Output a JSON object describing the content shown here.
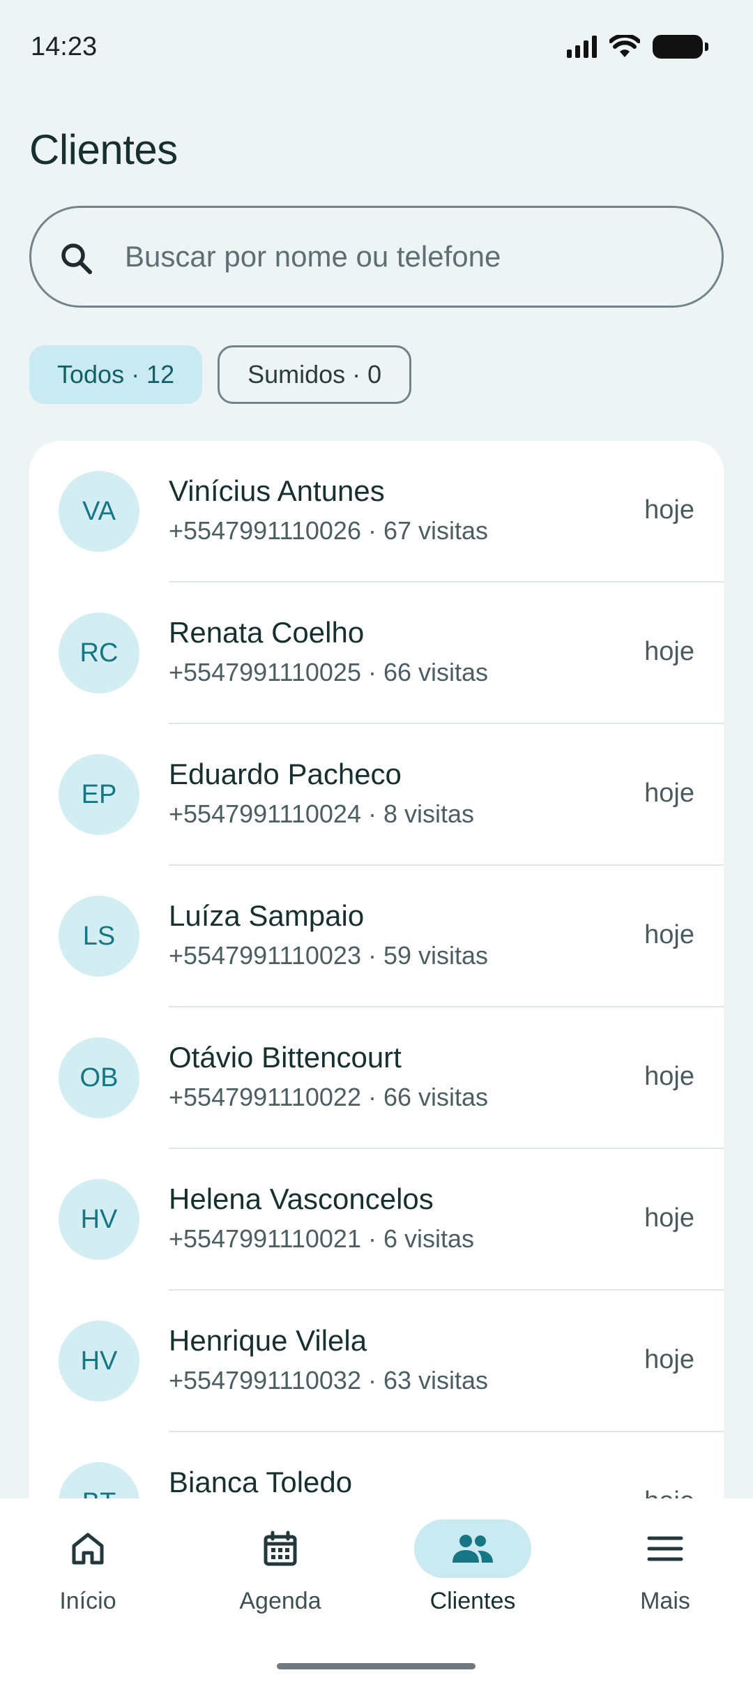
{
  "status_bar": {
    "time": "14:23"
  },
  "header": {
    "title": "Clientes"
  },
  "search": {
    "placeholder": "Buscar por nome ou telefone",
    "value": ""
  },
  "filters": [
    {
      "label": "Todos · 12",
      "selected": true
    },
    {
      "label": "Sumidos · 0",
      "selected": false
    }
  ],
  "clients": [
    {
      "initials": "VA",
      "name": "Vinícius Antunes",
      "meta": "+5547991110026 · 67 visitas",
      "when": "hoje"
    },
    {
      "initials": "RC",
      "name": "Renata Coelho",
      "meta": "+5547991110025 · 66 visitas",
      "when": "hoje"
    },
    {
      "initials": "EP",
      "name": "Eduardo Pacheco",
      "meta": "+5547991110024 · 8 visitas",
      "when": "hoje"
    },
    {
      "initials": "LS",
      "name": "Luíza Sampaio",
      "meta": "+5547991110023 · 59 visitas",
      "when": "hoje"
    },
    {
      "initials": "OB",
      "name": "Otávio Bittencourt",
      "meta": "+5547991110022 · 66 visitas",
      "when": "hoje"
    },
    {
      "initials": "HV",
      "name": "Helena Vasconcelos",
      "meta": "+5547991110021 · 6 visitas",
      "when": "hoje"
    },
    {
      "initials": "HV",
      "name": "Henrique Vilela",
      "meta": "+5547991110032 · 63 visitas",
      "when": "hoje"
    },
    {
      "initials": "BT",
      "name": "Bianca Toledo",
      "meta": "",
      "when": "hoje"
    }
  ],
  "nav": {
    "items": [
      {
        "label": "Início",
        "icon": "home-icon",
        "active": false
      },
      {
        "label": "Agenda",
        "icon": "calendar-icon",
        "active": false
      },
      {
        "label": "Clientes",
        "icon": "people-icon",
        "active": true
      },
      {
        "label": "Mais",
        "icon": "menu-icon",
        "active": false
      }
    ]
  },
  "colors": {
    "accent": "#167683",
    "accent_soft": "#c8eaf0",
    "background": "#eef3f4"
  }
}
